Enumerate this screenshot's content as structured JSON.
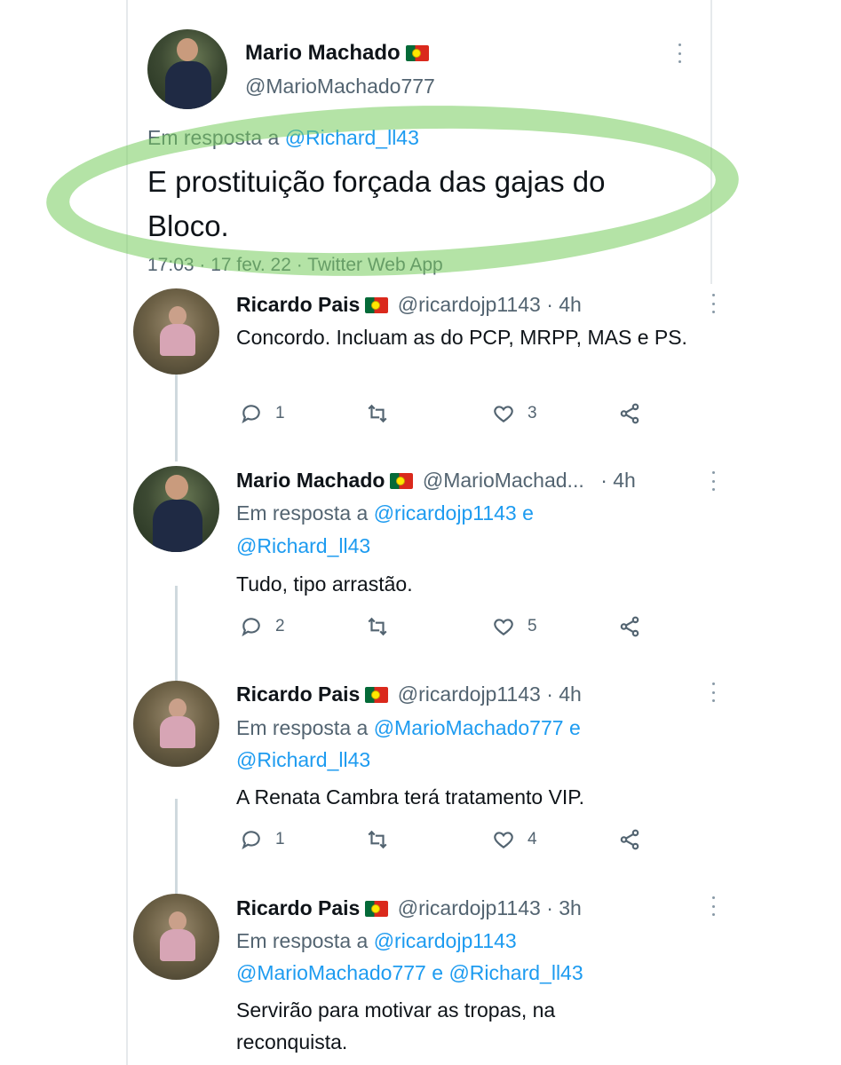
{
  "main_tweet": {
    "author_name": "Mario Machado",
    "author_handle": "@MarioMachado777",
    "replying_prefix": "Em resposta a",
    "replying_to": "@Richard_ll43",
    "text": "E prostituição forçada das gajas do Bloco.",
    "meta": "17:03 · 17 fev. 22 · Twitter Web App"
  },
  "replies": [
    {
      "author_name": "Ricardo Pais",
      "author_handle": "@ricardojp1143 · 4h",
      "replying_prefix": "",
      "replying_line1": "",
      "replying_line2": "",
      "text": "Concordo. Incluam as do PCP, MRPP, MAS e PS.",
      "replies_count": "1",
      "likes_count": "3"
    },
    {
      "author_name": "Mario Machado",
      "author_handle": "@MarioMachad...",
      "time": "· 4h",
      "replying_prefix": "Em resposta a",
      "replying_line1": "@ricardojp1143",
      "replying_conj": "e",
      "replying_line2": "@Richard_ll43",
      "text": "Tudo, tipo arrastão.",
      "replies_count": "2",
      "likes_count": "5"
    },
    {
      "author_name": "Ricardo Pais",
      "author_handle": "@ricardojp1143 · 4h",
      "replying_prefix": "Em resposta a",
      "replying_line1": "@MarioMachado777",
      "replying_conj": "e",
      "replying_line2": "@Richard_ll43",
      "text": "A Renata Cambra terá tratamento VIP.",
      "replies_count": "1",
      "likes_count": "4"
    },
    {
      "author_name": "Ricardo Pais",
      "author_handle": "@ricardojp1143 · 3h",
      "replying_prefix": "Em resposta a",
      "replying_line1": "@ricardojp1143",
      "replying_line2a": "@MarioMachado777",
      "replying_conj": "e",
      "replying_line2b": "@Richard_ll43",
      "text_line1": "Servirão para motivar as tropas, na",
      "text_line2": "reconquista."
    }
  ],
  "icons": {
    "reply": "reply-icon",
    "retweet": "retweet-icon",
    "like": "heart-icon",
    "share": "share-icon",
    "more": "more-icon",
    "flag": "portugal-flag-icon"
  },
  "colors": {
    "mention": "#1d9bf0",
    "secondary_text": "#536471",
    "highlight": "#76cc5c"
  }
}
